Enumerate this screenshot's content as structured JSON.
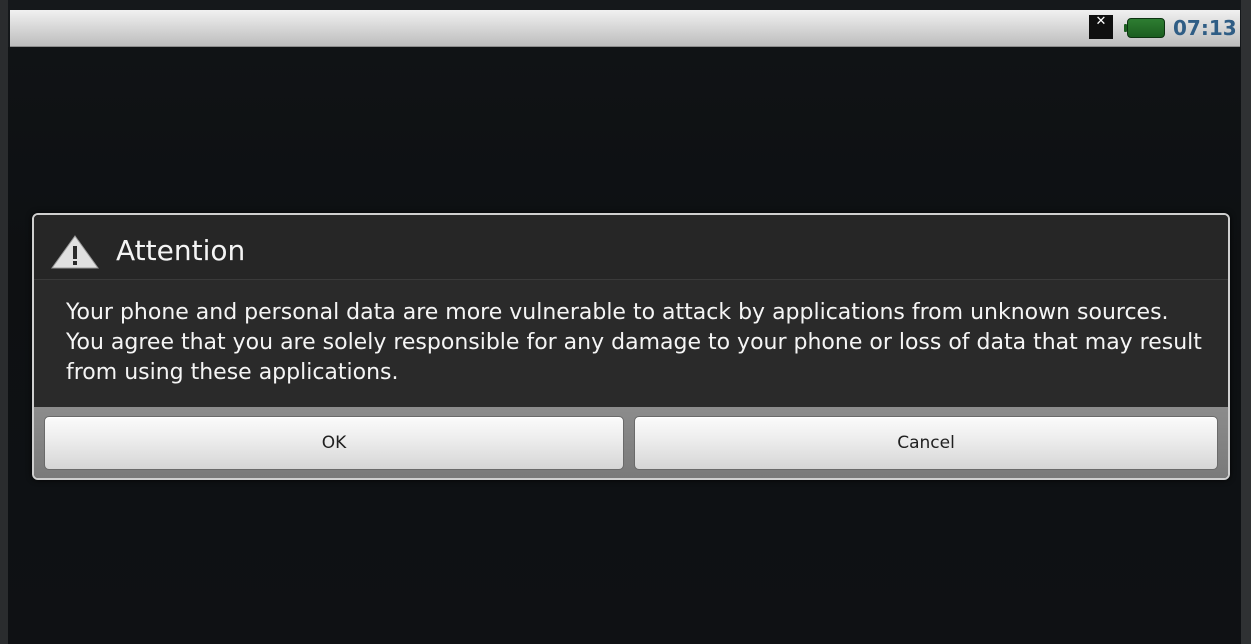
{
  "status_bar": {
    "time": "07:13",
    "notification_icon": "close-x-icon",
    "notification_glyph": "✕",
    "battery_icon": "battery-icon",
    "clock_color": "#2f5d85"
  },
  "dialog": {
    "title": "Attention",
    "title_icon": "warning-icon",
    "message": "Your phone and personal data are more vulnerable to attack by applications from unknown sources. You agree that you are solely responsible for any damage to your phone or loss of data that may result from using these applications.",
    "buttons": {
      "ok_label": "OK",
      "cancel_label": "Cancel"
    }
  },
  "colors": {
    "background": "#111315",
    "dialog_bg": "#2a2a2a",
    "button_bar": "#8c8c8c"
  }
}
